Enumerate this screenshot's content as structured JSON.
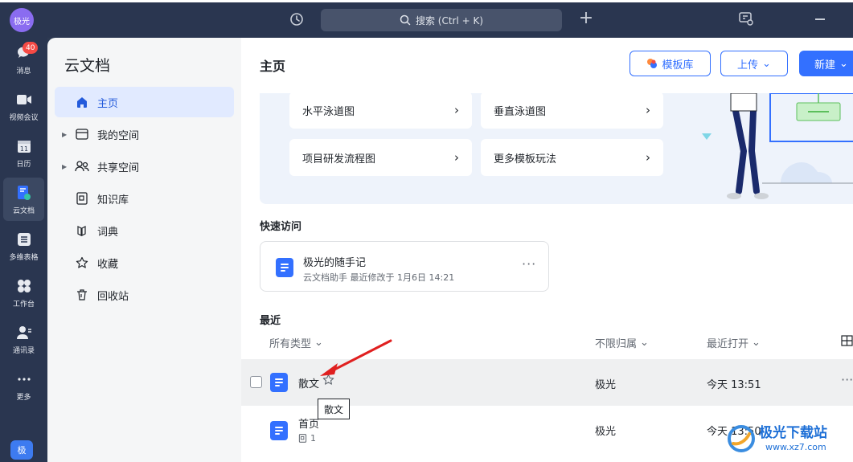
{
  "app": {
    "avatar_label": "极光"
  },
  "topbar": {
    "search_label": "搜索 (Ctrl + K)"
  },
  "rail": [
    {
      "label": "消息",
      "badge": "40"
    },
    {
      "label": "视频会议"
    },
    {
      "label": "日历"
    },
    {
      "label": "云文档",
      "active": true
    },
    {
      "label": "多维表格"
    },
    {
      "label": "工作台"
    },
    {
      "label": "通讯录"
    },
    {
      "label": "更多"
    }
  ],
  "rail_user": "极",
  "nav": {
    "title": "云文档",
    "items": [
      {
        "label": "主页",
        "icon": "home-icon",
        "active": true
      },
      {
        "label": "我的空间",
        "icon": "folder-icon",
        "expandable": true
      },
      {
        "label": "共享空间",
        "icon": "people-icon",
        "expandable": true
      },
      {
        "label": "知识库",
        "icon": "wiki-icon"
      },
      {
        "label": "词典",
        "icon": "dictionary-icon"
      },
      {
        "label": "收藏",
        "icon": "star-icon"
      },
      {
        "label": "回收站",
        "icon": "trash-icon"
      }
    ]
  },
  "main": {
    "title": "主页",
    "buttons": {
      "templates": "模板库",
      "upload": "上传",
      "new": "新建"
    },
    "templates": [
      "水平泳道图",
      "垂直泳道图",
      "项目研发流程图",
      "更多模板玩法"
    ],
    "quick_access": {
      "label": "快速访问",
      "card": {
        "title": "极光的随手记",
        "meta": "云文档助手 最近修改于 1月6日 14:21"
      }
    },
    "recent": {
      "label": "最近",
      "columns": {
        "type": "所有类型",
        "owner": "不限归属",
        "opened": "最近打开"
      },
      "rows": [
        {
          "name": "散文",
          "owner": "极光",
          "opened": "今天 13:51",
          "hovered": true
        },
        {
          "name": "首页",
          "sub": "1",
          "owner": "极光",
          "opened": "今天 13:50"
        }
      ],
      "tooltip": "散文"
    }
  },
  "watermark": {
    "text": "极光下载站",
    "url": "www.xz7.com"
  },
  "colors": {
    "accent": "#3370ff",
    "rail_bg": "#2a3650",
    "badge": "#f54a45",
    "arrow": "#e02020"
  }
}
